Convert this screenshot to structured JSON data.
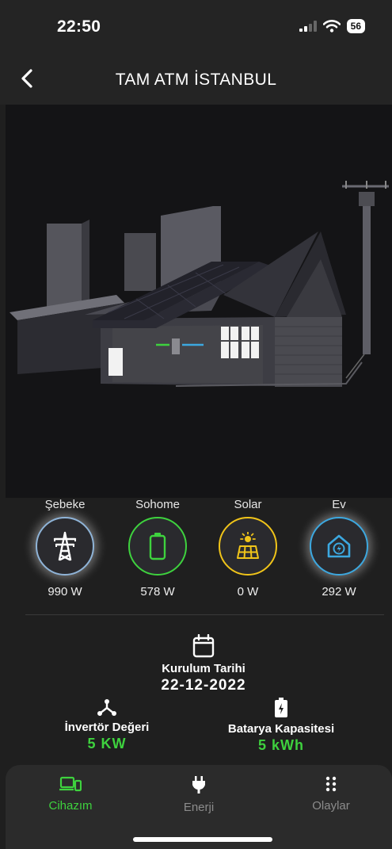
{
  "status_bar": {
    "time": "22:50",
    "battery": "56"
  },
  "header": {
    "title": "TAM ATM İSTANBUL"
  },
  "devices": [
    {
      "label": "Şebeke",
      "value": "990 W",
      "icon": "power-tower-icon",
      "color": "#8fb4d8"
    },
    {
      "label": "Sohome",
      "value": "578 W",
      "icon": "battery-icon",
      "color": "#3ed23e"
    },
    {
      "label": "Solar",
      "value": "0 W",
      "icon": "solar-panel-icon",
      "color": "#f0c419"
    },
    {
      "label": "Ev",
      "value": "292 W",
      "icon": "smart-home-icon",
      "color": "#3ca8e0"
    }
  ],
  "info": {
    "install_label": "Kurulum Tarihi",
    "install_date": "22-12-2022",
    "inverter_label": "İnvertör Değeri",
    "inverter_value": "5 KW",
    "battery_label": "Batarya Kapasitesi",
    "battery_value": "5 kWh"
  },
  "tabs": [
    {
      "label": "Cihazım",
      "icon": "devices-icon",
      "active": true
    },
    {
      "label": "Enerji",
      "icon": "plug-icon",
      "active": false
    },
    {
      "label": "Olaylar",
      "icon": "dots-grid-icon",
      "active": false
    }
  ],
  "colors": {
    "accent": "#3ed23e",
    "background": "#1f1f1f",
    "scene_background": "#141416"
  }
}
